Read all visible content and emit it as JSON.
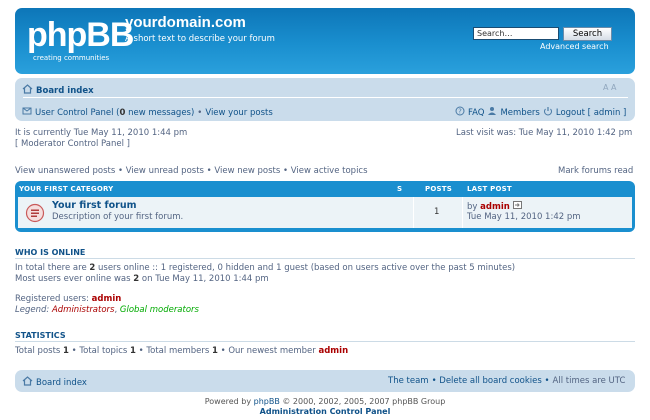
{
  "header": {
    "logo_text": "phpBB",
    "logo_tagline": "creating   communities",
    "site_title": "yourdomain.com",
    "site_description": "A short text to describe your forum",
    "search_placeholder": "Search…",
    "search_button": "Search",
    "advanced_search": "Advanced search",
    "gradient": [
      "#0d76b8",
      "#2aa0dc"
    ]
  },
  "navbar": {
    "board_index": "Board index",
    "font_size_control": "A A",
    "ucp_prefix": "User Control Panel (",
    "new_messages_count": "0",
    "ucp_suffix": "new messages)",
    "sep": "•",
    "view_posts": "View your posts",
    "faq": "FAQ",
    "members": "Members",
    "logout": "Logout [ admin ]"
  },
  "info": {
    "current_time": "It is currently Tue May 11, 2010 1:44 pm",
    "mod_panel": "[ Moderator Control Panel ]",
    "last_visit": "Last visit was: Tue May 11, 2010 1:42 pm"
  },
  "quick_links": {
    "text": "View unanswered posts • View unread posts • View new posts • View active topics",
    "mark_read": "Mark forums read"
  },
  "category": {
    "name": "YOUR FIRST CATEGORY",
    "topics_header": "S",
    "posts_header": "POSTS",
    "last_post_header": "LAST POST",
    "forum": {
      "title": "Your first forum",
      "description": "Description of your first forum.",
      "posts": "1",
      "by": "by",
      "author": "admin",
      "date": "Tue May 11, 2010 1:42 pm"
    }
  },
  "who_is_online": {
    "title": "WHO IS ONLINE",
    "line1_a": "In total there are",
    "line1_count": "2",
    "line1_b": "users online :: 1 registered, 0 hidden and 1 guest (based on users active over the past 5 minutes)",
    "line2_a": "Most users ever online was",
    "line2_count": "2",
    "line2_b": "on Tue May 11, 2010 1:44 pm",
    "registered_label": "Registered users:",
    "registered_user": "admin",
    "legend_label": "Legend:",
    "legend_admins": "Administrators",
    "legend_comma": ",",
    "legend_mods": "Global moderators"
  },
  "statistics": {
    "title": "STATISTICS",
    "posts_label": "Total posts",
    "posts_count": "1",
    "topics_label": "• Total topics",
    "topics_count": "1",
    "members_label": "• Total members",
    "members_count": "1",
    "newest_label": "• Our newest member",
    "newest_member": "admin"
  },
  "footer": {
    "board_index": "Board index",
    "the_team": "The team",
    "delete_cookies": "• Delete all board cookies •",
    "timezone": "All times are UTC",
    "powered_by": "Powered by",
    "phpbb_link": "phpBB",
    "copyright": "© 2000, 2002, 2005, 2007 phpBB Group",
    "acp": "Administration Control Panel"
  },
  "colors": {
    "accent": "#105289",
    "admin_red": "#aa0000",
    "mod_green": "#00aa00",
    "navbar_bg": "#cadceb"
  }
}
